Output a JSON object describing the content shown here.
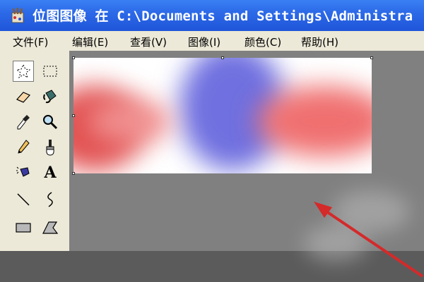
{
  "window": {
    "title": "位图图像 在 C:\\Documents and Settings\\Administra"
  },
  "menu": {
    "items": [
      {
        "label": "文件(F)"
      },
      {
        "label": "编辑(E)"
      },
      {
        "label": "查看(V)"
      },
      {
        "label": "图像(I)"
      },
      {
        "label": "颜色(C)"
      },
      {
        "label": "帮助(H)"
      }
    ]
  },
  "toolbox": {
    "tools": [
      {
        "name": "free-form-select-icon"
      },
      {
        "name": "rectangle-select-icon"
      },
      {
        "name": "eraser-icon"
      },
      {
        "name": "fill-bucket-icon"
      },
      {
        "name": "color-picker-icon"
      },
      {
        "name": "magnifier-icon"
      },
      {
        "name": "pencil-icon"
      },
      {
        "name": "brush-icon"
      },
      {
        "name": "airbrush-icon"
      },
      {
        "name": "text-icon",
        "glyph": "A"
      },
      {
        "name": "line-icon"
      },
      {
        "name": "curve-icon"
      },
      {
        "name": "rectangle-icon"
      },
      {
        "name": "polygon-icon"
      }
    ]
  },
  "colors": {
    "title_bar": "#2c6ae8",
    "workspace": "#808080",
    "menu_bg": "#ece9d8",
    "annotation_arrow": "#d42a2a"
  }
}
